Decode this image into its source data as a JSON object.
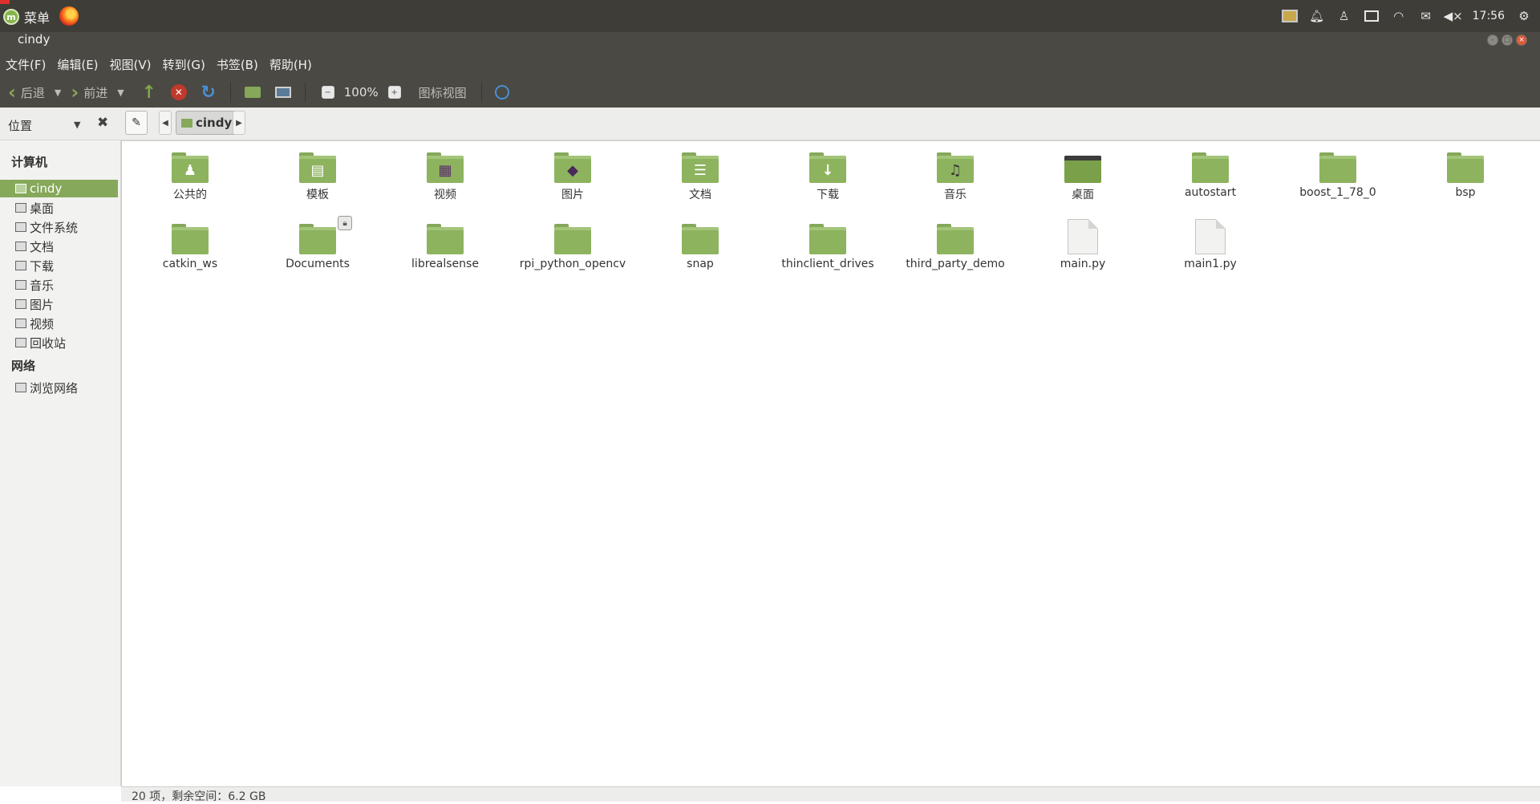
{
  "system_panel": {
    "menu_label": "菜单",
    "mint_glyph": "m",
    "tray_volume_glyph": "◀×",
    "clock": "17:56",
    "icons": [
      "screen-icon",
      "bell-icon",
      "user-icon",
      "keyboard-icon",
      "wifi-icon",
      "mail-icon",
      "volume-muted-icon",
      "gear-icon"
    ]
  },
  "window": {
    "title": "cindy",
    "controls": [
      "minimize",
      "maximize",
      "close"
    ]
  },
  "menubar": {
    "items": [
      "文件(F)",
      "编辑(E)",
      "视图(V)",
      "转到(G)",
      "书签(B)",
      "帮助(H)"
    ]
  },
  "toolbar": {
    "back_label": "后退",
    "forward_label": "前进",
    "zoom_value": "100%",
    "view_mode": "图标视图",
    "zoom_out_glyph": "−",
    "zoom_in_glyph": "+"
  },
  "location_bar": {
    "mode_label": "位置",
    "current_folder": "cindy"
  },
  "sidebar": {
    "sections": [
      {
        "heading": "计算机",
        "items": [
          {
            "label": "cindy",
            "selected": true
          },
          {
            "label": "桌面"
          },
          {
            "label": "文件系统"
          },
          {
            "label": "文档"
          },
          {
            "label": "下载"
          },
          {
            "label": "音乐"
          },
          {
            "label": "图片"
          },
          {
            "label": "视频"
          },
          {
            "label": "回收站"
          }
        ]
      },
      {
        "heading": "网络",
        "items": [
          {
            "label": "浏览网络"
          }
        ]
      }
    ]
  },
  "files": [
    {
      "name": "公共的",
      "kind": "folder",
      "emblem": "user-icon"
    },
    {
      "name": "模板",
      "kind": "folder",
      "emblem": "template-icon"
    },
    {
      "name": "视频",
      "kind": "folder",
      "emblem": "film-icon"
    },
    {
      "name": "图片",
      "kind": "folder",
      "emblem": "picture-icon"
    },
    {
      "name": "文档",
      "kind": "folder",
      "emblem": "document-icon"
    },
    {
      "name": "下载",
      "kind": "folder",
      "emblem": "download-icon"
    },
    {
      "name": "音乐",
      "kind": "folder",
      "emblem": "music-icon"
    },
    {
      "name": "桌面",
      "kind": "desktop"
    },
    {
      "name": "autostart",
      "kind": "folder"
    },
    {
      "name": "boost_1_78_0",
      "kind": "folder"
    },
    {
      "name": "bsp",
      "kind": "folder"
    },
    {
      "name": "catkin_ws",
      "kind": "folder"
    },
    {
      "name": "Documents",
      "kind": "folder",
      "locked": true
    },
    {
      "name": "librealsense",
      "kind": "folder"
    },
    {
      "name": "rpi_python_opencv",
      "kind": "folder"
    },
    {
      "name": "snap",
      "kind": "folder"
    },
    {
      "name": "thinclient_drives",
      "kind": "folder"
    },
    {
      "name": "third_party_demo",
      "kind": "folder"
    },
    {
      "name": "main.py",
      "kind": "file"
    },
    {
      "name": "main1.py",
      "kind": "file"
    }
  ],
  "statusbar": {
    "text": "20 项，剩余空间：6.2 GB"
  },
  "colors": {
    "panel": "#3f3d38",
    "header": "#4b4943",
    "accent": "#86a85a",
    "folder": "#8db35e"
  }
}
